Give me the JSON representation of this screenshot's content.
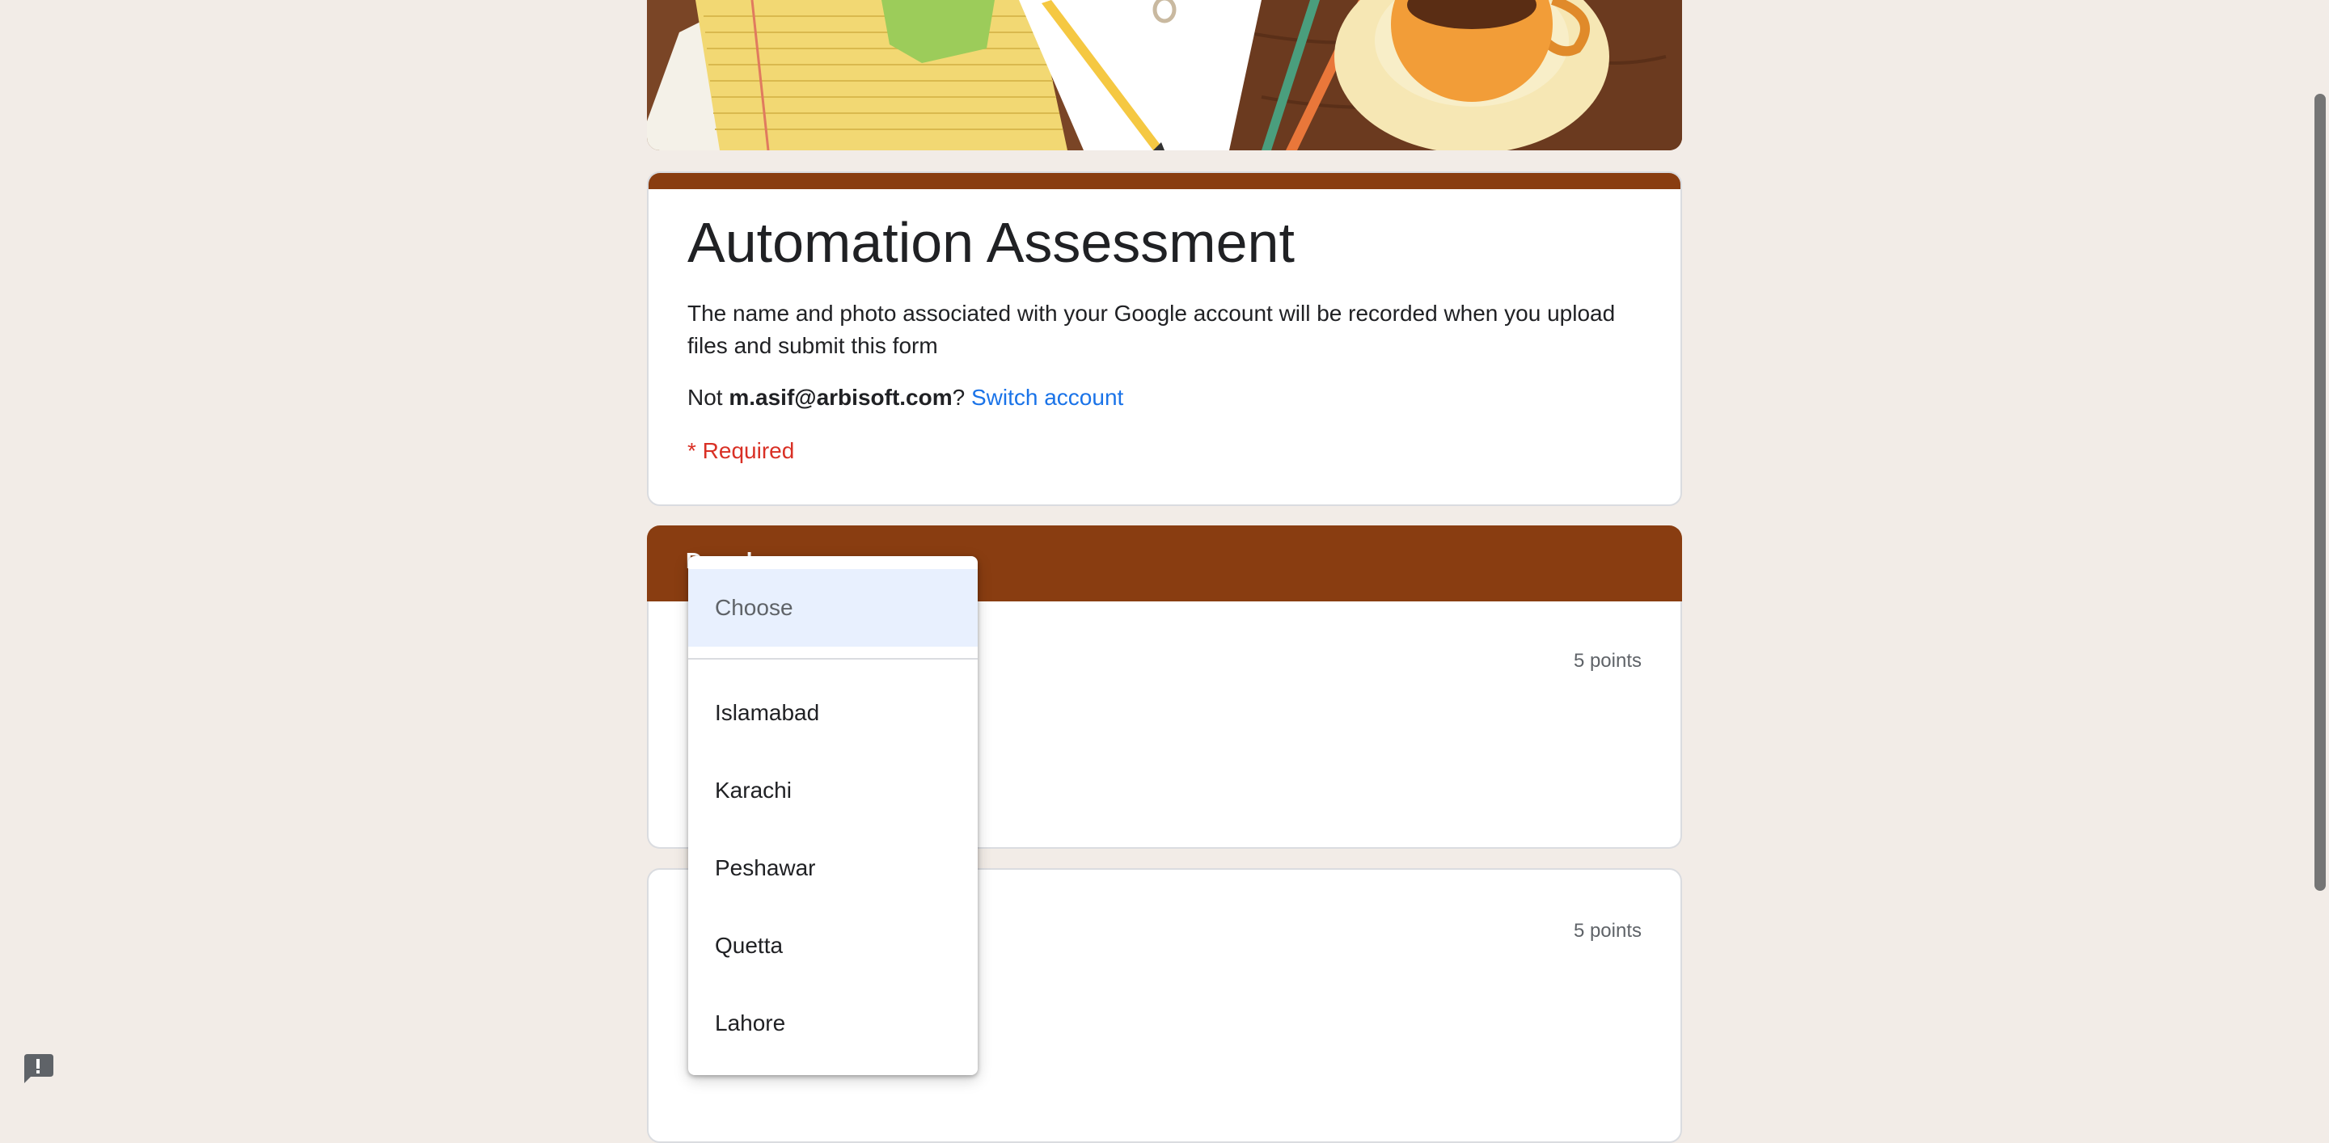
{
  "form": {
    "title": "Automation Assessment",
    "description": "The name and photo associated with your Google account will be recorded when you upload files and submit this form",
    "account_prefix": "Not ",
    "account_email": "m.asif@arbisoft.com",
    "account_suffix": "? ",
    "switch_account": "Switch account",
    "required_note": "* Required"
  },
  "section": {
    "title": "Dropd"
  },
  "questions": [
    {
      "points": "5 points"
    },
    {
      "points": "5 points"
    }
  ],
  "dropdown": {
    "placeholder": "Choose",
    "options": [
      "Islamabad",
      "Karachi",
      "Peshawar",
      "Quetta",
      "Lahore"
    ]
  },
  "icons": {
    "feedback": "report-feedback-icon"
  },
  "colors": {
    "theme": "#893d11",
    "background": "#f2ece7",
    "link": "#1a73e8",
    "required": "#d93025",
    "highlight": "#e8f0fe"
  }
}
